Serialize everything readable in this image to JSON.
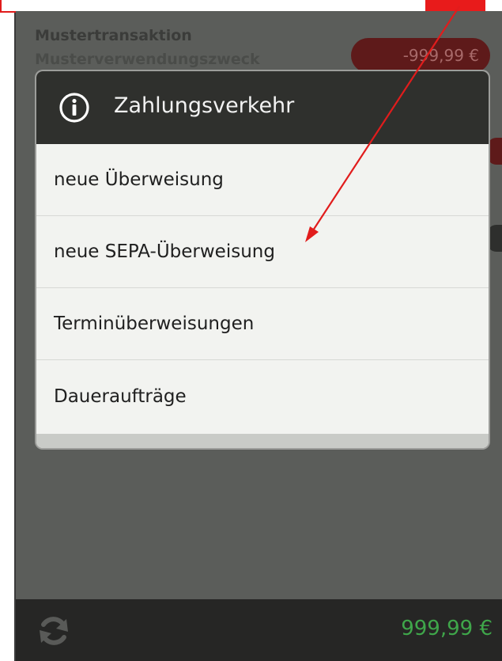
{
  "transaction": {
    "title": "Mustertransaktion",
    "purpose": "Musterverwendungszweck",
    "amount": "-999,99 €"
  },
  "dialog": {
    "title": "Zahlungsverkehr",
    "icon": "info-icon",
    "items": [
      {
        "label": "neue Überweisung"
      },
      {
        "label": "neue SEPA-Überweisung"
      },
      {
        "label": "Terminüberweisungen"
      },
      {
        "label": "Daueraufträge"
      }
    ]
  },
  "bottom_bar": {
    "refresh_icon": "refresh-icon",
    "balance": "999,99 €"
  },
  "colors": {
    "annotation": "#e11c1c",
    "balance_green": "#3fa64a",
    "negative_amount_bg": "#5e1a1a"
  }
}
